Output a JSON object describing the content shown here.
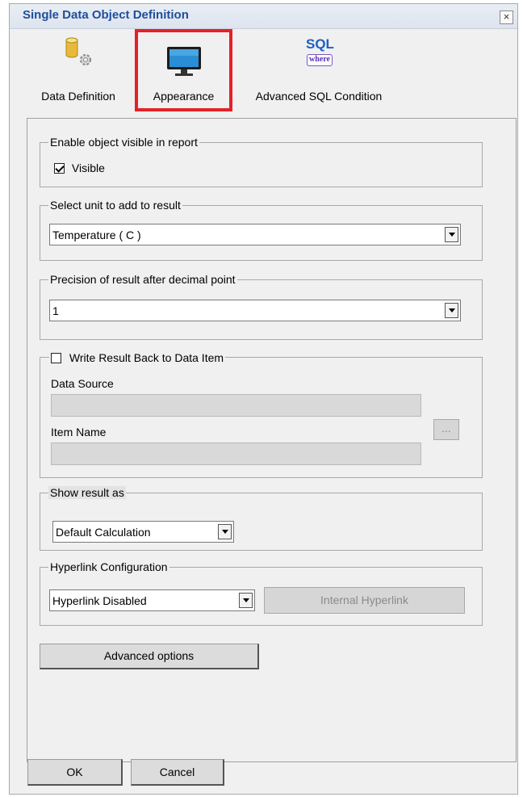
{
  "dialog": {
    "title": "Single Data Object Definition",
    "close_symbol": "×"
  },
  "tabs": [
    {
      "label": "Data Definition",
      "icon": "database-gear-icon",
      "active": false
    },
    {
      "label": "Appearance",
      "icon": "monitor-icon",
      "active": true
    },
    {
      "label": "Advanced SQL Condition",
      "icon": "sql-where-icon",
      "active": false
    }
  ],
  "sql_icon": {
    "top": "SQL",
    "bottom": "where"
  },
  "visibility": {
    "legend": "Enable object visible in report",
    "checkbox_label": "Visible",
    "checked": true
  },
  "unit": {
    "legend": "Select unit to add to result",
    "value": "Temperature ( C )"
  },
  "precision": {
    "legend": "Precision of result after decimal point",
    "value": "1"
  },
  "write_back": {
    "legend": "Write Result Back to Data Item",
    "checked": false,
    "data_source_label": "Data Source",
    "data_source_value": "",
    "item_name_label": "Item Name",
    "item_name_value": "",
    "browse_label": "..."
  },
  "show_result": {
    "legend": "Show result as",
    "value": "Default Calculation"
  },
  "hyperlink": {
    "legend": "Hyperlink Configuration",
    "value": "Hyperlink Disabled",
    "internal_button": "Internal Hyperlink"
  },
  "advanced_options_label": "Advanced options",
  "footer": {
    "ok_label": "OK",
    "cancel_label": "Cancel"
  },
  "colors": {
    "title_text": "#1f4e9b",
    "active_tab_border": "#e5202a"
  }
}
